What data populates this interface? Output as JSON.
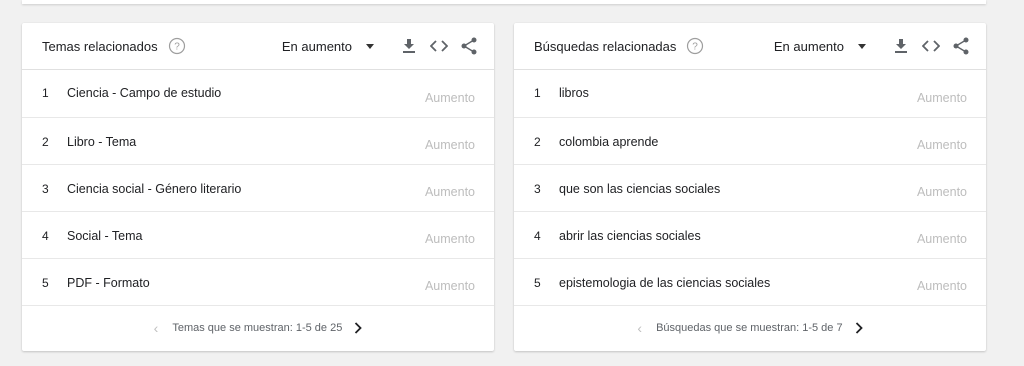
{
  "panels": [
    {
      "title": "Temas relacionados",
      "dropdown": "En aumento",
      "rows": [
        {
          "index": "1",
          "label": "Ciencia - Campo de estudio",
          "value": "Aumento"
        },
        {
          "index": "2",
          "label": "Libro - Tema",
          "value": "Aumento"
        },
        {
          "index": "3",
          "label": "Ciencia social - Género literario",
          "value": "Aumento"
        },
        {
          "index": "4",
          "label": "Social - Tema",
          "value": "Aumento"
        },
        {
          "index": "5",
          "label": "PDF - Formato",
          "value": "Aumento"
        }
      ],
      "footer": "Temas que se muestran: 1-5 de 25"
    },
    {
      "title": "Búsquedas relacionadas",
      "dropdown": "En aumento",
      "rows": [
        {
          "index": "1",
          "label": "libros",
          "value": "Aumento"
        },
        {
          "index": "2",
          "label": "colombia aprende",
          "value": "Aumento"
        },
        {
          "index": "3",
          "label": "que son las ciencias sociales",
          "value": "Aumento"
        },
        {
          "index": "4",
          "label": "abrir las ciencias sociales",
          "value": "Aumento"
        },
        {
          "index": "5",
          "label": "epistemologia de las ciencias sociales",
          "value": "Aumento"
        }
      ],
      "footer": "Búsquedas que se muestran: 1-5 de 7"
    }
  ],
  "icons": {
    "help": "help-circle-icon",
    "download": "download-icon",
    "embed": "code-embed-icon",
    "share": "share-icon",
    "prev": "chevron-left-icon",
    "next": "chevron-right-icon"
  },
  "colors": {
    "muted_value": "#bdbdbd",
    "icon": "#5f6368",
    "background": "#f1f1f1"
  }
}
